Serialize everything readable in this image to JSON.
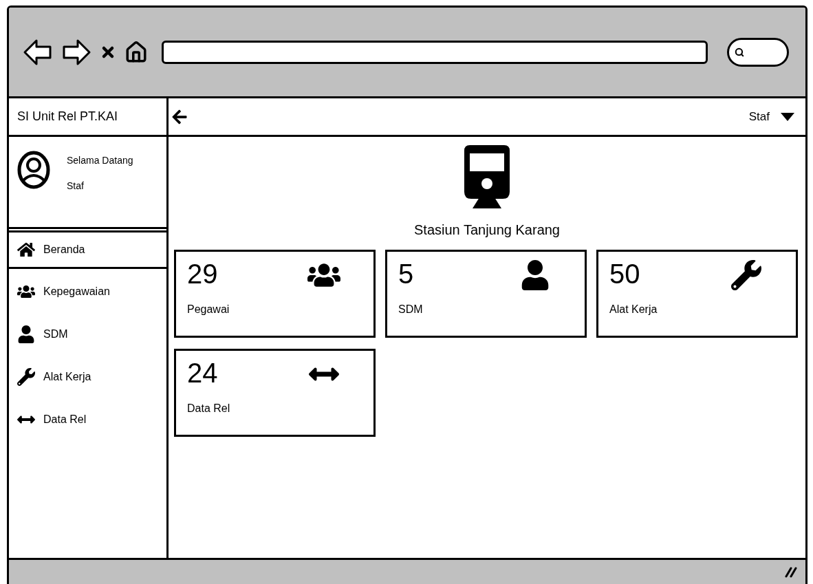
{
  "app_title": "SI Unit Rel PT.KAI",
  "user_menu": {
    "label": "Staf"
  },
  "profile": {
    "greeting": "Selama Datang",
    "role": "Staf"
  },
  "nav": [
    {
      "label": "Beranda",
      "selected": true
    },
    {
      "label": "Kepegawaian",
      "selected": false
    },
    {
      "label": "SDM",
      "selected": false
    },
    {
      "label": "Alat Kerja",
      "selected": false
    },
    {
      "label": "Data Rel",
      "selected": false
    }
  ],
  "station": {
    "name": "Stasiun Tanjung Karang"
  },
  "stats": [
    {
      "value": "29",
      "label": "Pegawai"
    },
    {
      "value": "5",
      "label": "SDM"
    },
    {
      "value": "50",
      "label": "Alat Kerja"
    },
    {
      "value": "24",
      "label": "Data Rel"
    }
  ]
}
